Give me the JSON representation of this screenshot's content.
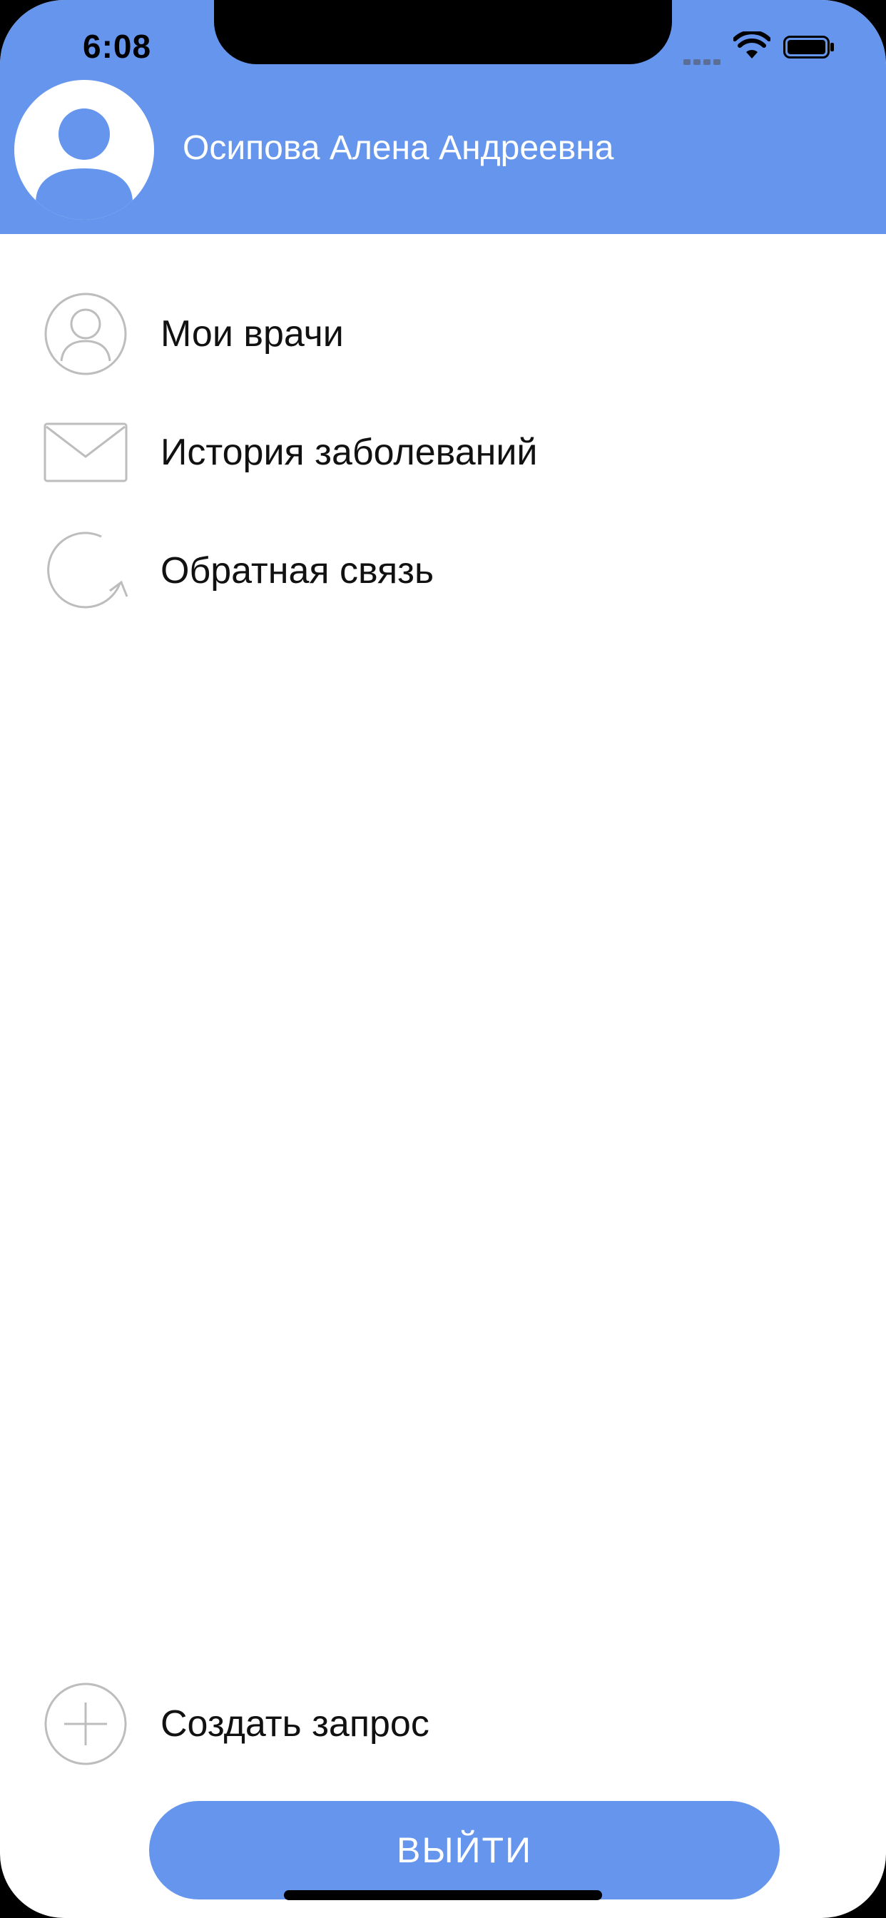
{
  "colors": {
    "accent": "#6595EC",
    "icon_stroke": "#BDBDBD",
    "text": "#111111"
  },
  "status_bar": {
    "time": "6:08",
    "icons": [
      "signal-icon",
      "wifi-icon",
      "battery-icon"
    ]
  },
  "header": {
    "avatar_icon": "person-icon",
    "user_name": "Осипова Алена Андреевна"
  },
  "menu": {
    "items": [
      {
        "icon": "person-circle-icon",
        "label": "Мои врачи"
      },
      {
        "icon": "envelope-icon",
        "label": "История заболеваний"
      },
      {
        "icon": "refresh-icon",
        "label": "Обратная связь"
      }
    ]
  },
  "footer": {
    "create_request": {
      "icon": "plus-circle-icon",
      "label": "Создать запрос"
    },
    "logout_label": "ВЫЙТИ"
  }
}
